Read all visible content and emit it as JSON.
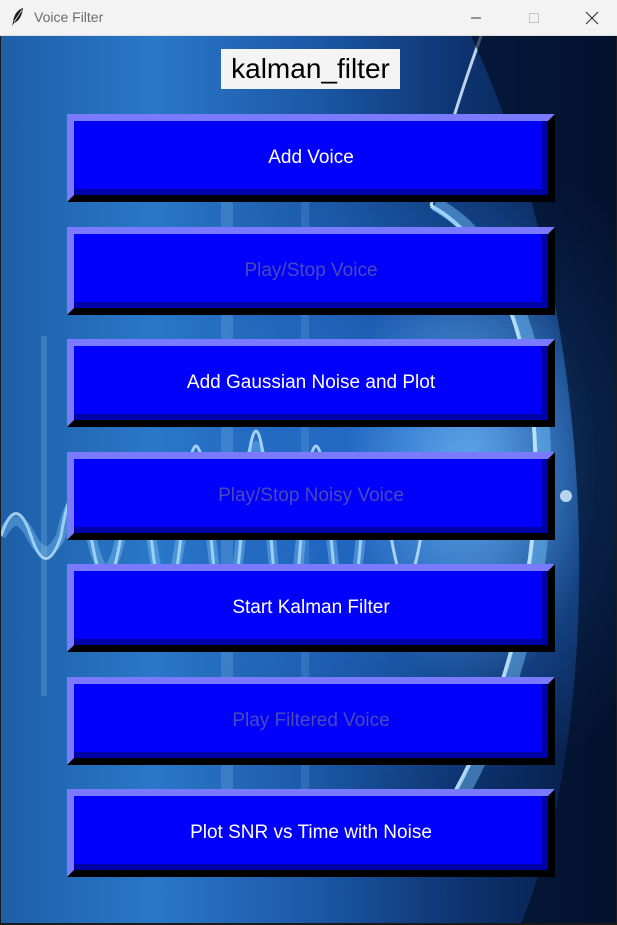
{
  "window": {
    "title": "Voice Filter"
  },
  "header": {
    "label": "kalman_filter"
  },
  "buttons": [
    {
      "label": "Add Voice",
      "enabled": true
    },
    {
      "label": "Play/Stop Voice",
      "enabled": false
    },
    {
      "label": "Add Gaussian Noise and Plot",
      "enabled": true
    },
    {
      "label": "Play/Stop Noisy Voice",
      "enabled": false
    },
    {
      "label": "Start Kalman Filter",
      "enabled": true
    },
    {
      "label": "Play Filtered Voice",
      "enabled": false
    },
    {
      "label": "Plot SNR vs Time with Noise",
      "enabled": true
    }
  ],
  "colors": {
    "button_face": "#0000fc",
    "button_highlight": "#7a7aff",
    "button_shadow": "#000000",
    "enabled_text": "#ffffff",
    "disabled_text": "#4a4ab8"
  },
  "icons": {
    "app": "feather-icon",
    "minimize": "minimize-icon",
    "maximize": "maximize-icon",
    "close": "close-icon"
  }
}
